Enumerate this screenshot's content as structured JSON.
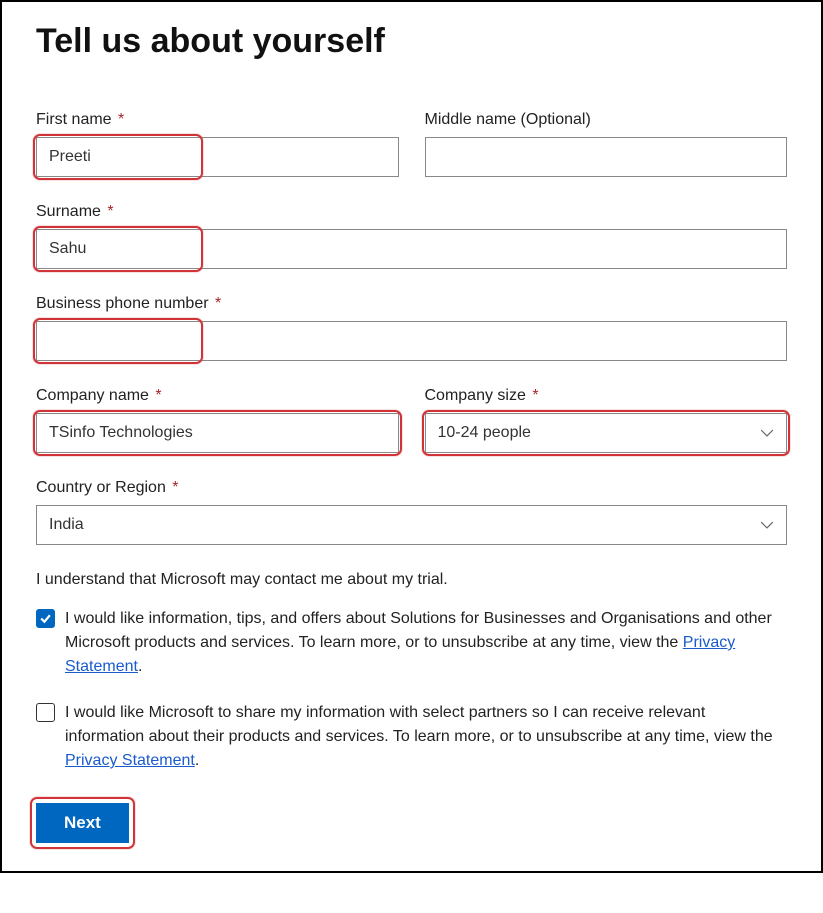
{
  "heading": "Tell us about yourself",
  "fields": {
    "firstName": {
      "label": "First name",
      "required": true,
      "value": "Preeti"
    },
    "middleName": {
      "label": "Middle name (Optional)",
      "required": false,
      "value": ""
    },
    "surname": {
      "label": "Surname",
      "required": true,
      "value": "Sahu"
    },
    "phone": {
      "label": "Business phone number",
      "required": true,
      "value": ""
    },
    "company": {
      "label": "Company name",
      "required": true,
      "value": "TSinfo Technologies"
    },
    "companySize": {
      "label": "Company size",
      "required": true,
      "value": "10-24 people"
    },
    "country": {
      "label": "Country or Region",
      "required": true,
      "value": "India"
    }
  },
  "consentIntro": "I understand that Microsoft may contact me about my trial.",
  "checks": {
    "info": {
      "checked": true,
      "pre": "I would like information, tips, and offers about Solutions for Businesses and Organisations and other Microsoft products and services. To learn more, or to unsubscribe at any time, view the ",
      "link": "Privacy Statement",
      "post": "."
    },
    "share": {
      "checked": false,
      "pre": "I would like Microsoft to share my information with select partners so I can receive relevant information about their products and services. To learn more, or to unsubscribe at any time, view the ",
      "link": "Privacy Statement",
      "post": "."
    }
  },
  "buttons": {
    "next": "Next"
  },
  "requiredMark": "*"
}
